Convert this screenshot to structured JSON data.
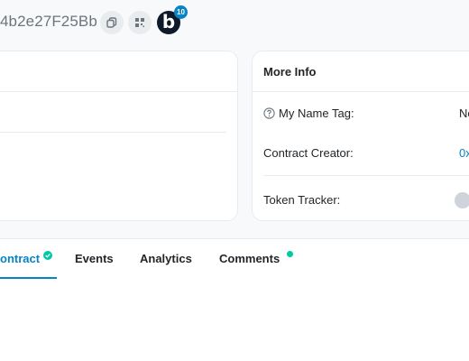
{
  "header": {
    "address_fragment": "4b2e27F25Bb",
    "notification_count": "10",
    "blockscan_letter": "b",
    "icons": [
      "copy-icon",
      "qr-code-icon",
      "blockscan-chat-icon"
    ]
  },
  "more_info": {
    "title": "More Info",
    "name_tag_label": "My Name Tag:",
    "name_tag_value_fragment": "Nе",
    "contract_creator_label": "Contract Creator:",
    "contract_creator_value_fragment": "0x",
    "token_tracker_label": "Token Tracker:"
  },
  "tabs": [
    {
      "label": "ontract",
      "active": true
    },
    {
      "label": "Events",
      "active": false
    },
    {
      "label": "Analytics",
      "active": false
    },
    {
      "label": "Comments",
      "active": false
    }
  ],
  "colors": {
    "accent": "#0784c3",
    "verified": "#00c9a7",
    "background": "#f8f9fa"
  }
}
